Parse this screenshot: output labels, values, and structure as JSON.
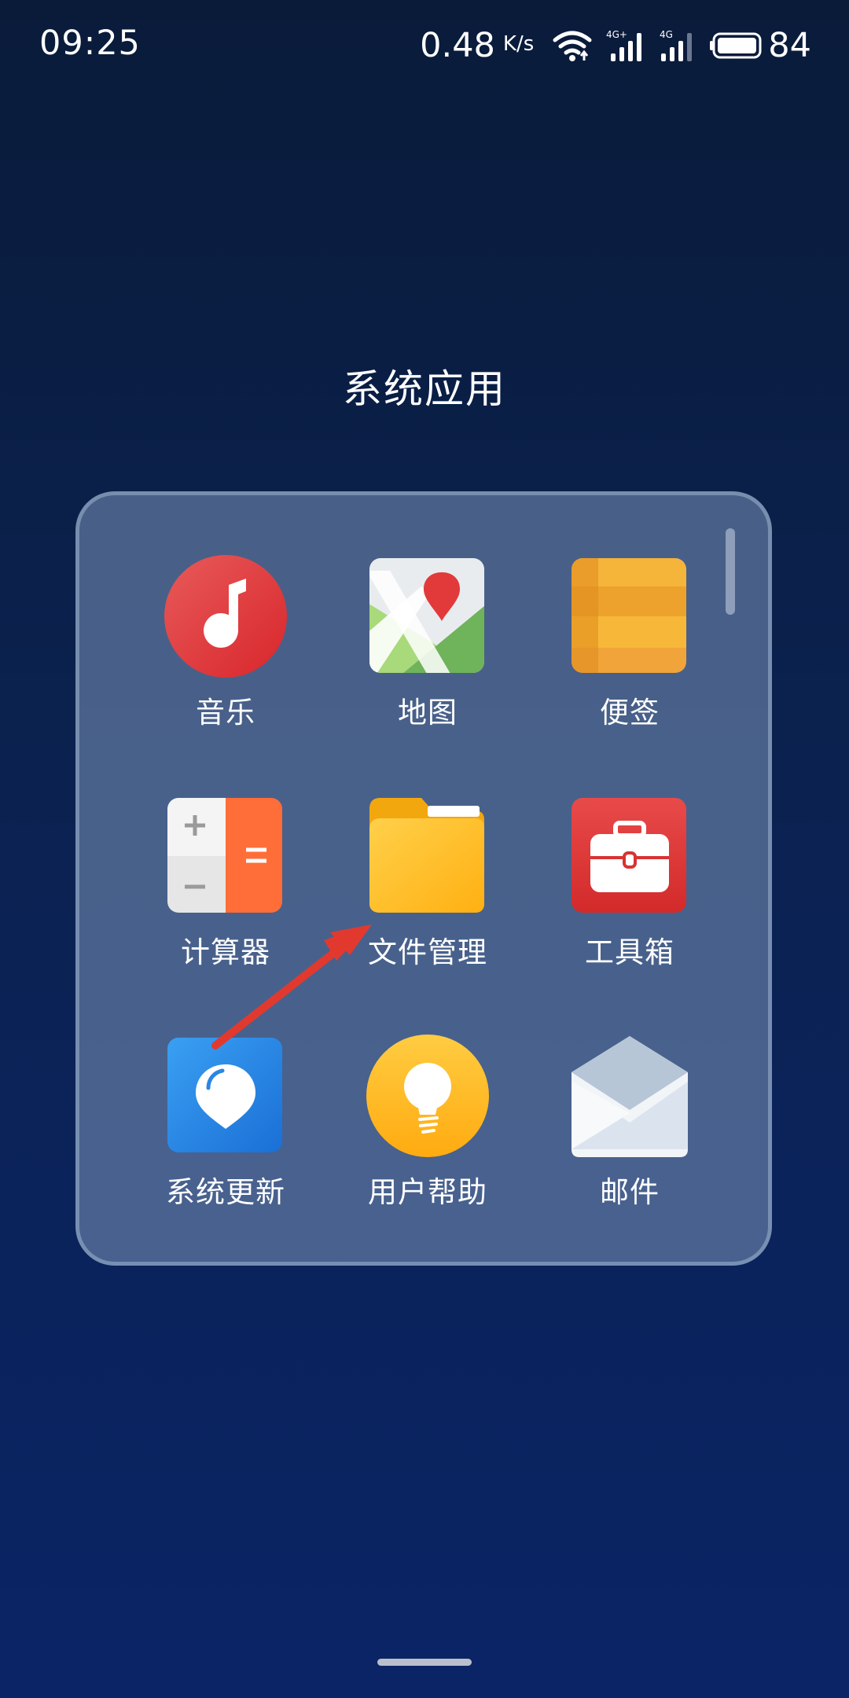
{
  "status_bar": {
    "time": "09:25",
    "net_speed": "0.48",
    "net_unit": "K/s",
    "signal1_label": "4G+",
    "signal2_label": "4G",
    "battery": "84"
  },
  "folder": {
    "title": "系统应用",
    "apps": [
      {
        "label": "音乐",
        "icon": "music-icon"
      },
      {
        "label": "地图",
        "icon": "map-icon"
      },
      {
        "label": "便签",
        "icon": "notes-icon"
      },
      {
        "label": "计算器",
        "icon": "calculator-icon"
      },
      {
        "label": "文件管理",
        "icon": "folder-icon"
      },
      {
        "label": "工具箱",
        "icon": "toolbox-icon"
      },
      {
        "label": "系统更新",
        "icon": "system-update-icon"
      },
      {
        "label": "用户帮助",
        "icon": "lightbulb-icon"
      },
      {
        "label": "邮件",
        "icon": "mail-icon"
      }
    ]
  },
  "annotation": {
    "icon": "red-arrow-icon",
    "color": "#e2392f"
  }
}
